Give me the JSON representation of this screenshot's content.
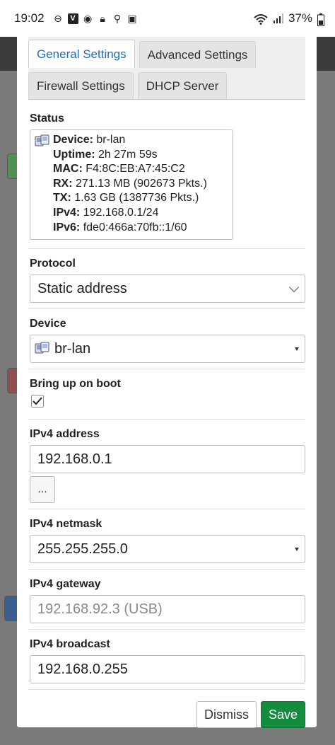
{
  "statusbar": {
    "time": "19:02",
    "battery": "37%"
  },
  "tabs": [
    {
      "label": "General Settings",
      "active": true
    },
    {
      "label": "Advanced Settings",
      "active": false
    },
    {
      "label": "Firewall Settings",
      "active": false
    },
    {
      "label": "DHCP Server",
      "active": false
    }
  ],
  "status": {
    "label": "Status",
    "device_key": "Device:",
    "device_val": "br-lan",
    "uptime_key": "Uptime:",
    "uptime_val": "2h 27m 59s",
    "mac_key": "MAC:",
    "mac_val": "F4:8C:EB:A7:45:C2",
    "rx_key": "RX:",
    "rx_val": "271.13 MB (902673 Pkts.)",
    "tx_key": "TX:",
    "tx_val": "1.63 GB (1387736 Pkts.)",
    "ipv4_key": "IPv4:",
    "ipv4_val": "192.168.0.1/24",
    "ipv6_key": "IPv6:",
    "ipv6_val": "fde0:466a:70fb::1/60"
  },
  "protocol": {
    "label": "Protocol",
    "value": "Static address"
  },
  "device": {
    "label": "Device",
    "value": "br-lan"
  },
  "boot": {
    "label": "Bring up on boot",
    "checked": true
  },
  "ipv4_address": {
    "label": "IPv4 address",
    "value": "192.168.0.1",
    "more": "..."
  },
  "ipv4_netmask": {
    "label": "IPv4 netmask",
    "value": "255.255.255.0"
  },
  "ipv4_gateway": {
    "label": "IPv4 gateway",
    "placeholder": "192.168.92.3 (USB)"
  },
  "ipv4_broadcast": {
    "label": "IPv4 broadcast",
    "value": "192.168.0.255"
  },
  "footer": {
    "dismiss": "Dismiss",
    "save": "Save"
  }
}
